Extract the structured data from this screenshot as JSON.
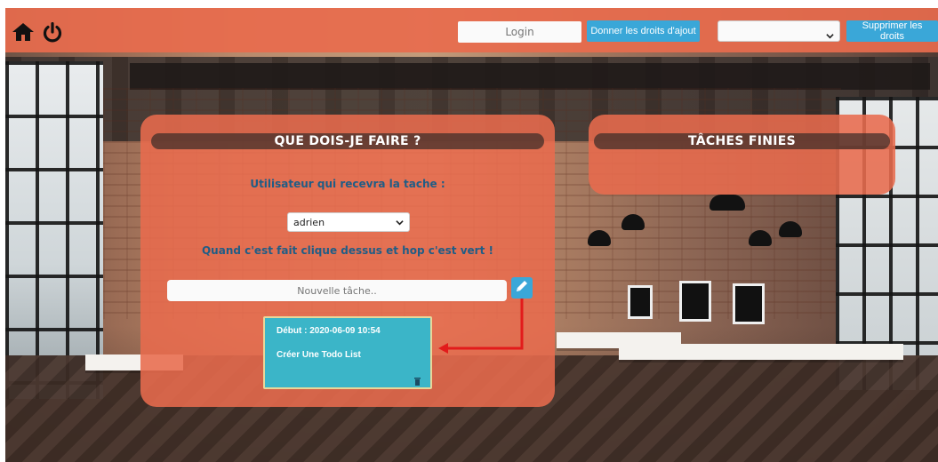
{
  "topbar": {
    "login_placeholder": "Login",
    "grant_button_label": "Donner les droits d'ajout",
    "user_select_value": "",
    "delete_button_label": "Supprimer les droits",
    "home_icon": "home-icon",
    "power_icon": "power-icon"
  },
  "todo_panel": {
    "title": "QUE DOIS-JE FAIRE ?",
    "recipient_label": "Utilisateur qui recevra la tache :",
    "recipient_value": "adrien",
    "hint": "Quand c'est fait clique dessus et hop c'est vert !",
    "new_task_placeholder": "Nouvelle tâche.."
  },
  "task": {
    "date": "Début : 2020-06-09 10:54",
    "title": "Créer Une Todo List"
  },
  "done_panel": {
    "title": "TÂCHES FINIES"
  },
  "colors": {
    "panel": "#E86B4D",
    "button": "#3AA7D8",
    "card": "#3BB5C8",
    "text_blue": "#1F5D86",
    "arrow": "#E21B1B"
  }
}
